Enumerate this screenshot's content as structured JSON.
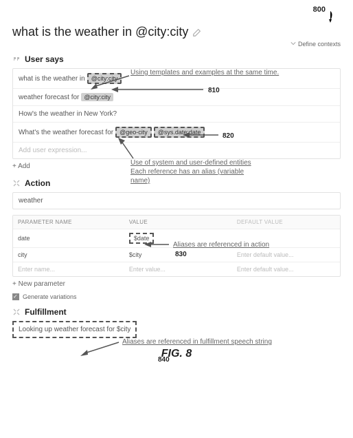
{
  "figure_number_top": "800",
  "title": "what is the weather in @city:city",
  "define_contexts_label": "Define contexts",
  "sections": {
    "user_says": {
      "heading": "User says",
      "rows": [
        {
          "prefix": "what is the weather in",
          "chip1": "@city:city"
        },
        {
          "prefix": "weather forecast for",
          "chip1": "@city:city"
        },
        {
          "prefix": "How's the weather in New York?"
        },
        {
          "prefix": "What's the weather forecast for",
          "chip1": "@geo-city",
          "chip2": "@sys.date:date"
        }
      ],
      "placeholder": "Add user expression...",
      "add_label": "+ Add"
    },
    "action": {
      "heading": "Action",
      "value": "weather",
      "params": {
        "headers": {
          "a": "Parameter Name",
          "b": "Value",
          "c": "Default Value"
        },
        "rows": [
          {
            "name": "date",
            "value": "$date",
            "default": ""
          },
          {
            "name": "city",
            "value": "$city",
            "default": "Enter default value..."
          }
        ],
        "placeholder": {
          "name": "Enter name...",
          "value": "Enter value...",
          "default": "Enter default value..."
        }
      },
      "new_param_label": "+ New parameter",
      "generate_variations_label": "Generate variations"
    },
    "fulfillment": {
      "heading": "Fulfillment",
      "speech": "Looking up weather forecast for $city"
    }
  },
  "annotations": {
    "anno1": "Using templates and examples at the same time.",
    "anno2_line1": "Use of system and user-defined entities",
    "anno2_line2": "Each reference has an alias (variable",
    "anno2_line3": "name)",
    "anno3": "Aliases are referenced in action",
    "anno4": "Aliases are referenced in fulfillment speech string"
  },
  "callouts": {
    "c810": "810",
    "c820": "820",
    "c830": "830",
    "c840": "840"
  },
  "figure_caption": "FIG. 8"
}
